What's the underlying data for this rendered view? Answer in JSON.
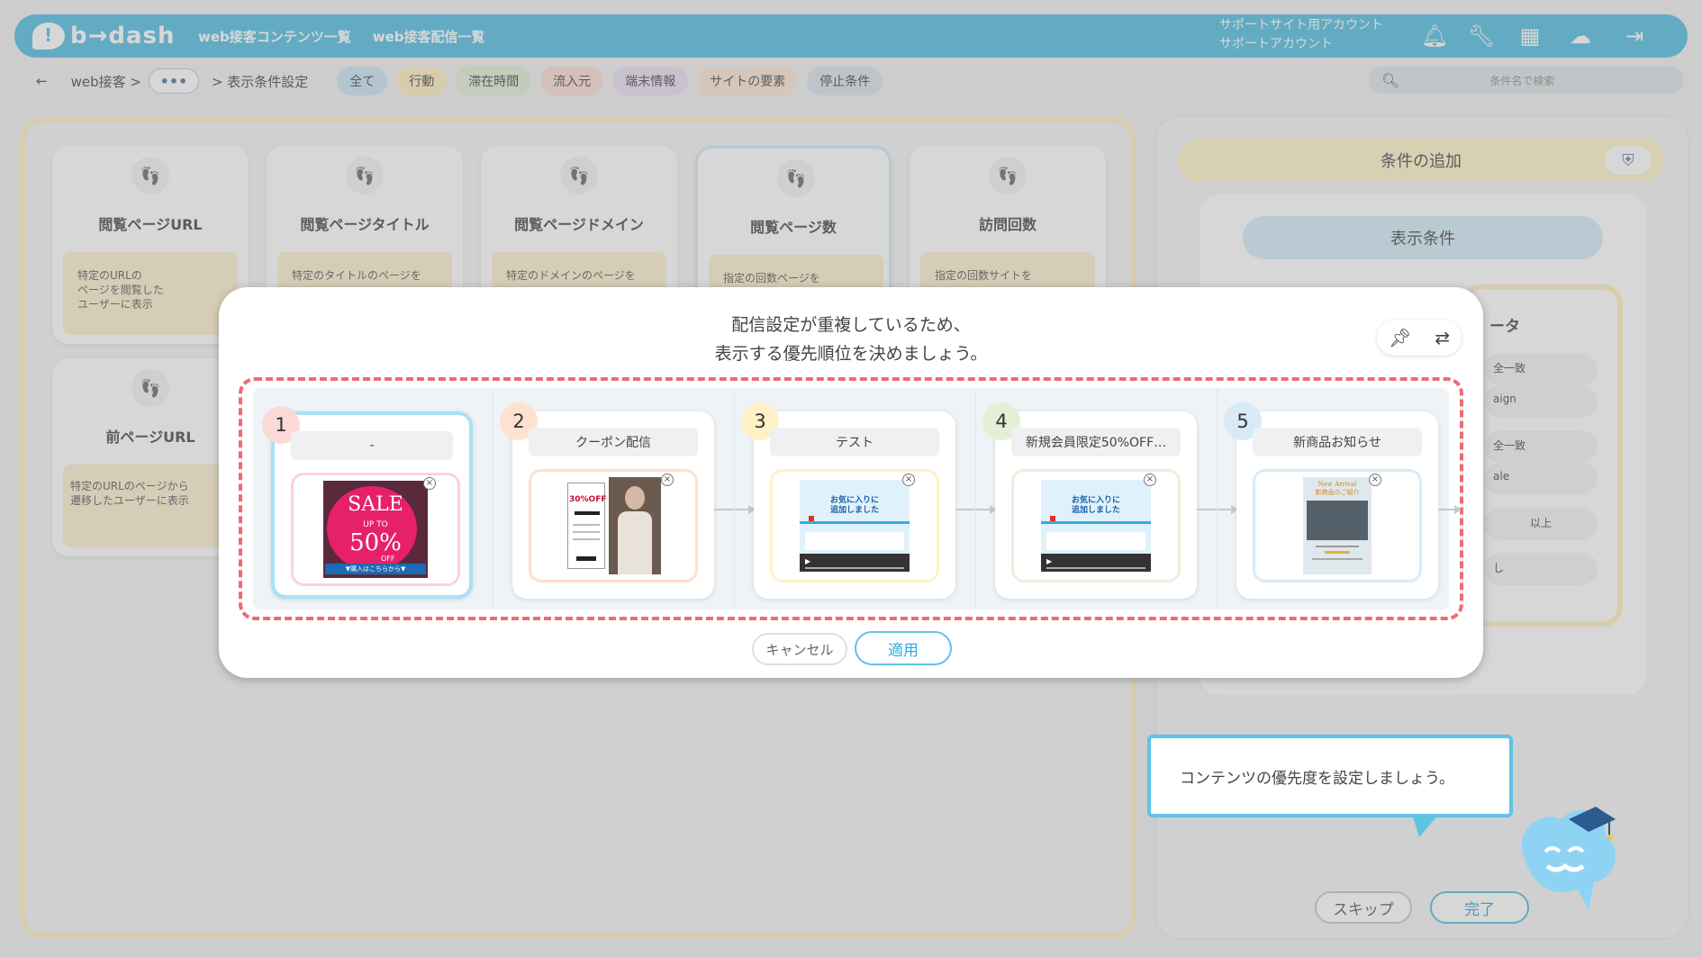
{
  "header": {
    "logo": "b→dash",
    "nav": [
      "web接客コンテンツ一覧",
      "web接客配信一覧"
    ],
    "account_lines": [
      "サポートサイト用アカウント",
      "サポートアカウント"
    ],
    "icons": [
      "bell-icon",
      "wrench-icon",
      "grid-icon",
      "brain-icon",
      "logout-icon"
    ]
  },
  "breadcrumb": {
    "back": "←",
    "root": "web接客 >",
    "more": "•••",
    "current": "> 表示条件設定"
  },
  "filter_chips": [
    {
      "label": "全て",
      "color": "#cfe6f4"
    },
    {
      "label": "行動",
      "color": "#fff0c5"
    },
    {
      "label": "滞在時間",
      "color": "#e3efd9"
    },
    {
      "label": "流入元",
      "color": "#fbe0d9"
    },
    {
      "label": "端末情報",
      "color": "#ece2f3"
    },
    {
      "label": "サイトの要素",
      "color": "#fbe8d7"
    },
    {
      "label": "停止条件",
      "color": "#dde6ee"
    }
  ],
  "search": {
    "placeholder": "条件名で検索"
  },
  "condition_cards": [
    {
      "title": "閲覧ページURL",
      "desc": "特定のURLの\nページを閲覧した\nユーザーに表示"
    },
    {
      "title": "閲覧ページタイトル",
      "desc": "特定のタイトルのページを"
    },
    {
      "title": "閲覧ページドメイン",
      "desc": "特定のドメインのページを"
    },
    {
      "title": "閲覧ページ数",
      "desc": "指定の回数ページを"
    },
    {
      "title": "訪問回数",
      "desc": "指定の回数サイトを"
    },
    {
      "title": "前ページURL",
      "desc": "特定のURLのページから\n遷移したユーザーに表示"
    }
  ],
  "right_panel": {
    "add_condition": "条件の追加",
    "display_condition": "表示条件",
    "filter_title": "ータ",
    "rows": [
      "全一致",
      "aign",
      "全一致",
      "ale",
      "以上",
      "し"
    ],
    "skip": "スキップ",
    "done": "完了"
  },
  "modal": {
    "heading_line1": "配信設定が重複しているため、",
    "heading_line2": "表示する優先順位を決めましょう。",
    "tools": [
      "pin-icon",
      "swap-icon"
    ],
    "items": [
      {
        "num": "1",
        "name": "-",
        "num_color": "#fbd9d6",
        "border": "#fbd4d4"
      },
      {
        "num": "2",
        "name": "クーポン配信",
        "num_color": "#fde2d0",
        "border": "#fde0cf"
      },
      {
        "num": "3",
        "name": "テスト",
        "num_color": "#fff0c5",
        "border": "#fff0c9"
      },
      {
        "num": "4",
        "name": "新規会員限定50%OFF…",
        "num_color": "#e6efd6",
        "border": "#e9f0dc"
      },
      {
        "num": "5",
        "name": "新商品お知らせ",
        "num_color": "#d8eaf6",
        "border": "#d8ebf8"
      }
    ],
    "banner1": {
      "sale": "SALE",
      "upto": "UP TO",
      "pct": "50%",
      "off": "OFF",
      "cta": "▼購入はこちらから▼"
    },
    "banner2": {
      "pct": "30%OFF"
    },
    "banner3": {
      "msg_line1": "お気に入りに",
      "msg_line2": "追加しました"
    },
    "banner5": {
      "line1": "New Arrival",
      "line2": "新商品のご紹介"
    },
    "cancel": "キャンセル",
    "apply": "適用"
  },
  "tooltip": {
    "text": "コンテンツの優先度を設定しましょう。"
  }
}
